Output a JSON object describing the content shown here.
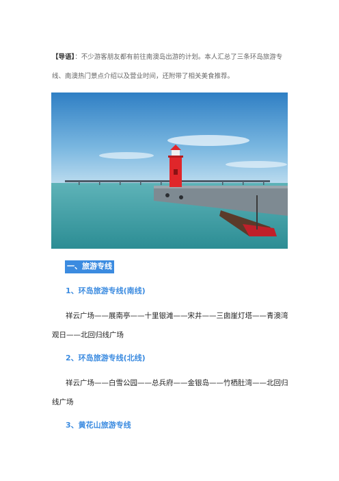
{
  "intro": {
    "lead": "【导语】",
    "body": "：不少游客朋友都有前往南澳岛出游的计划。本人汇总了三条环岛旅游专线、南澳热门景点介绍以及营业时间，还附带了相关美食推荐。"
  },
  "photo": {
    "colors": {
      "sky_top": "#2f7fc4",
      "sky_bottom": "#bcdcef",
      "sea": "#3f9fa5",
      "lighthouse": "#e0262a"
    }
  },
  "sections": {
    "s1_title": "一、旅游专线",
    "r1_title": "1、环岛旅游专线(南线)",
    "r1_text": "祥云广场——展南亭——十里银滩——宋井——三囱崖灯塔——青澳湾观日——北回归线广场",
    "r2_title": "2、环岛旅游专线(北线)",
    "r2_text": "祥云广场——白雪公园——总兵府——金银岛——竹栖肚湾——北回归线广场",
    "r3_title": "3、黄花山旅游专线"
  },
  "colors": {
    "accent": "#3b8be0",
    "text": "#222222"
  }
}
